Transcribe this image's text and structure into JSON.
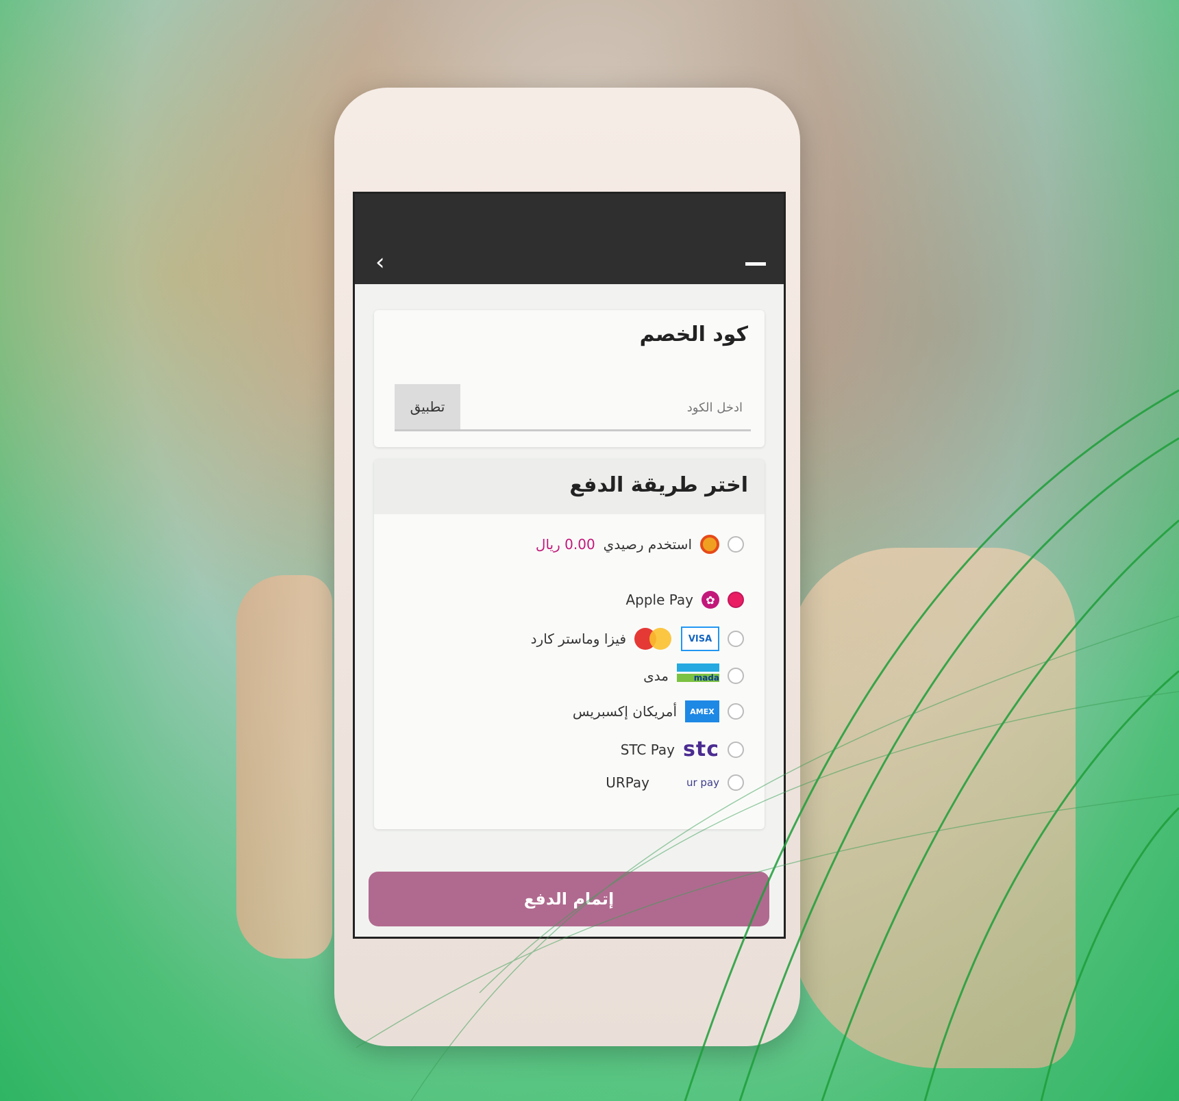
{
  "status_bar": {
    "carrier": "",
    "indicators": ""
  },
  "nav": {
    "title": "",
    "back_icon": "chevron-left-icon",
    "menu_icon": "menu-icon"
  },
  "promo": {
    "title": "كود الخصم",
    "apply_label": "تطبيق",
    "input_placeholder": "ادخل الكود"
  },
  "payment": {
    "title": "اختر طريقة الدفع",
    "methods": [
      {
        "label": "استخدم رصيدي",
        "balance": "0.00 ريال",
        "icon": "wallet-icon",
        "selected": false
      },
      {
        "label": "Apple Pay",
        "icon": "apple-pay-icon",
        "selected": true
      },
      {
        "label": "فيزا وماستر كارد",
        "icon": "visa-mastercard-icon",
        "selected": false
      },
      {
        "label": "مدى",
        "icon": "mada-icon",
        "selected": false
      },
      {
        "label": "أمريكان إكسبريس",
        "icon": "amex-icon",
        "selected": false
      },
      {
        "label": "STC Pay",
        "icon": "stc-pay-icon",
        "selected": false
      },
      {
        "label": "URPay",
        "icon": "urpay-icon",
        "selected": false
      }
    ]
  },
  "actions": {
    "pay_label": "إتمام الدفع"
  },
  "colors": {
    "accent": "#b06a8f",
    "balance": "#c2187a",
    "bar": "#2f2f2f",
    "background_green": "#2fb564"
  }
}
